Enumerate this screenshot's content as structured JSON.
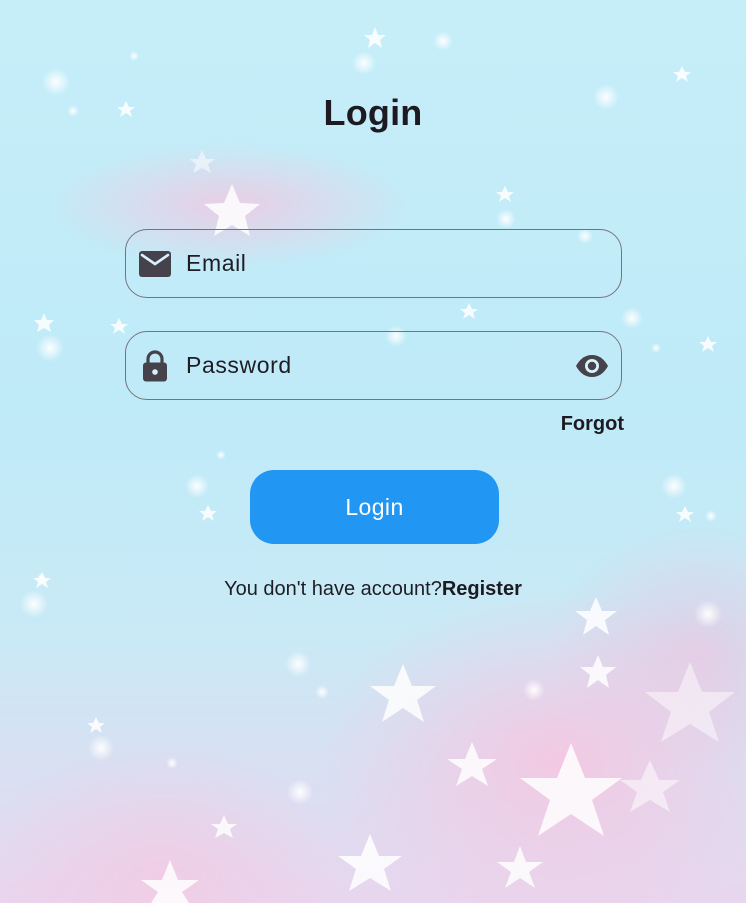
{
  "screen": {
    "title": "Login"
  },
  "form": {
    "email_placeholder": "Email",
    "email_icon": "mail-icon",
    "password_placeholder": "Password",
    "password_icon": "lock-icon",
    "visibility_icon": "eye-icon",
    "forgot_label": "Forgot",
    "login_button_label": "Login"
  },
  "footer": {
    "prompt_text": "You don't have account?",
    "register_label": "Register"
  },
  "colors": {
    "primary_button": "#2196f3",
    "field_border": "#77737c",
    "text": "#1d1b21"
  }
}
